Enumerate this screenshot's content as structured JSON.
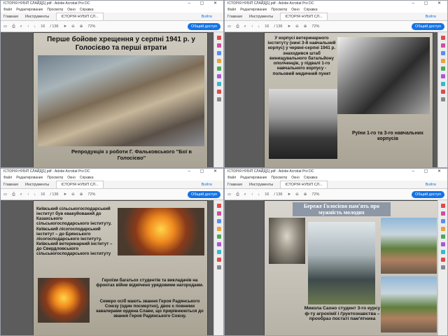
{
  "window_title": "ІСТОРІЯ НУБІП СЛАЙД[1].pdf - Adobe Acrobat Pro DC",
  "menu": [
    "Файл",
    "Редактирование",
    "Просмотр",
    "Окно",
    "Справка"
  ],
  "tabs": {
    "home": "Главная",
    "tools": "Инструменты",
    "doc": "ІСТОРІЯ НУБІП СЛ...",
    "signin": "Войти"
  },
  "toolbar": {
    "page": "16",
    "page_total": "/ 136",
    "zoom": "72%",
    "share": "Общий доступ"
  },
  "slide1": {
    "title": "Перше бойове хрещення у серпні 1941 р. у Голосієво та перші втрати",
    "caption": "Репродукція з роботи Г. Фальковського \"Бої в Голосієво\""
  },
  "slide2": {
    "text": "У корпусі ветеринарного інституту (нині 3-й навчальний корпус) у червні-серпні 1941 р. знаходився штаб винищувального батальйону ополченців, у підвалі 1-го навчального корпусу - польовий медичний пункт",
    "caption": "Руїни 1-го та 3-го навчальних корпусів"
  },
  "slide3": {
    "text1": "Київський сільськогосподарський інститут був евакуйований до Казахського сільськогосподарського інституту. Київський лісогосподарський інститут – до Брянського лісогосподарського інституту. Київський ветеринарний інститут – до Свердловського сільськогосподарського інституту",
    "text2": "Героїзм багатьох студентів та викладачів на фронтах війни відмічено урядовими нагородами.",
    "text3": "Семеро осіб мають звання Героя Радянського Союзу (один посмертно), двоє є повними кавалерами ордена Слави, що прирівнюються до звання Героя Радянського Союзу."
  },
  "slide4": {
    "banner": "Бережe Голосієво пам'ять про мужність молодих",
    "caption": "Микола Сахно студент 3-го курсу ф-ту агрохімії і ґрунтознавства – прообраз постаті пам'ятника"
  },
  "colors": {
    "accent": "#1473e6",
    "slide_bg": "#bfb9ab"
  }
}
